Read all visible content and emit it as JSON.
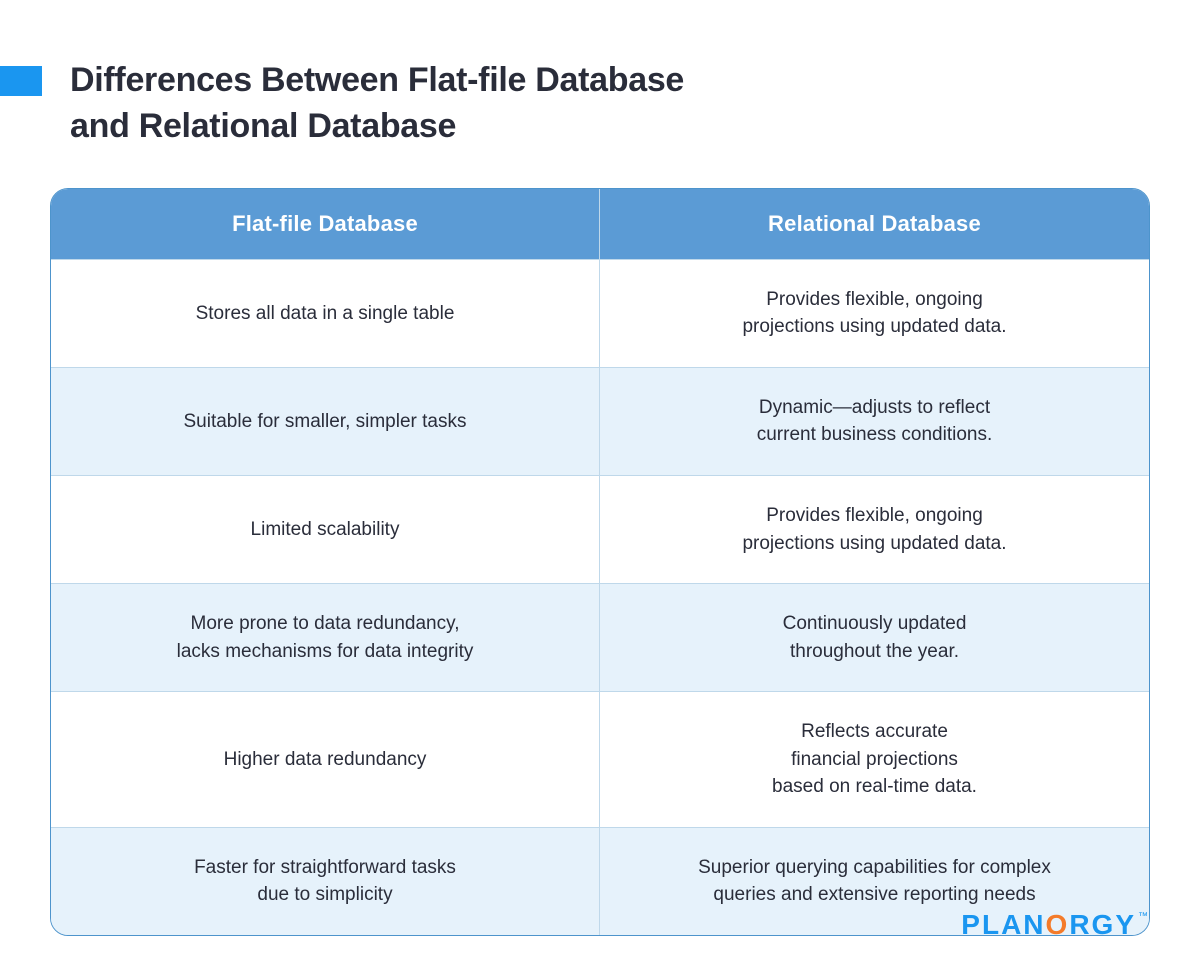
{
  "title": {
    "line1": "Differences Between Flat-file Database",
    "line2": "and Relational Database"
  },
  "headers": {
    "left": "Flat-file Database",
    "right": "Relational Database"
  },
  "rows": [
    {
      "left": "Stores all data in a single table",
      "right": "Provides flexible, ongoing\nprojections using updated data."
    },
    {
      "left": "Suitable for smaller, simpler tasks",
      "right": "Dynamic—adjusts to reflect\ncurrent business conditions."
    },
    {
      "left": "Limited scalability",
      "right": "Provides flexible, ongoing\nprojections using updated data."
    },
    {
      "left": "More prone to data redundancy,\nlacks mechanisms for data integrity",
      "right": "Continuously updated\nthroughout the year."
    },
    {
      "left": "Higher data redundancy",
      "right": "Reflects accurate\nfinancial projections\nbased on real-time data."
    },
    {
      "left": "Faster for straightforward tasks\ndue to simplicity",
      "right": "Superior querying capabilities for complex\nqueries and extensive reporting needs"
    }
  ],
  "logo": {
    "prefix": "PLAN",
    "o": "O",
    "suffix": "RGY",
    "tm": "™"
  },
  "colors": {
    "accent": "#1a96f0",
    "header": "#5b9bd5",
    "altRow": "#e6f2fb",
    "border": "#bfd8ea",
    "text": "#2a2d3a",
    "orange": "#f47b2a"
  }
}
